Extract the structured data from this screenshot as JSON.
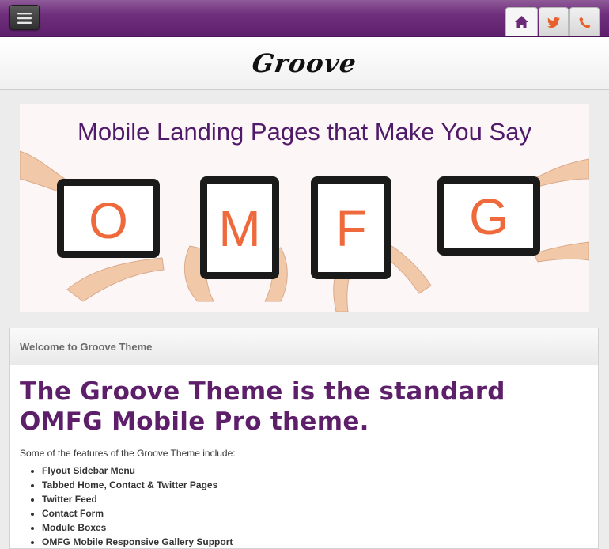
{
  "header": {
    "logo_text": "Groove"
  },
  "nav": {
    "menu_icon": "hamburger-icon",
    "tabs": [
      {
        "name": "home",
        "icon": "home-icon",
        "active": true
      },
      {
        "name": "twitter",
        "icon": "twitter-bird-icon",
        "active": false
      },
      {
        "name": "contact",
        "icon": "phone-icon",
        "active": false
      }
    ]
  },
  "banner": {
    "title": "Mobile Landing Pages that Make You Say",
    "letters": [
      "O",
      "M",
      "F",
      "G"
    ]
  },
  "content": {
    "box_title": "Welcome to Groove Theme",
    "headline": "The Groove Theme is the standard OMFG Mobile Pro theme.",
    "intro": "Some of the features of the Groove Theme include:",
    "features": [
      "Flyout Sidebar Menu",
      "Tabbed Home, Contact & Twitter Pages",
      "Twitter Feed",
      "Contact Form",
      "Module Boxes",
      "OMFG Mobile Responsive Gallery Support"
    ]
  },
  "colors": {
    "brand_purple": "#5e1f6a",
    "accent_orange": "#e8602c"
  }
}
